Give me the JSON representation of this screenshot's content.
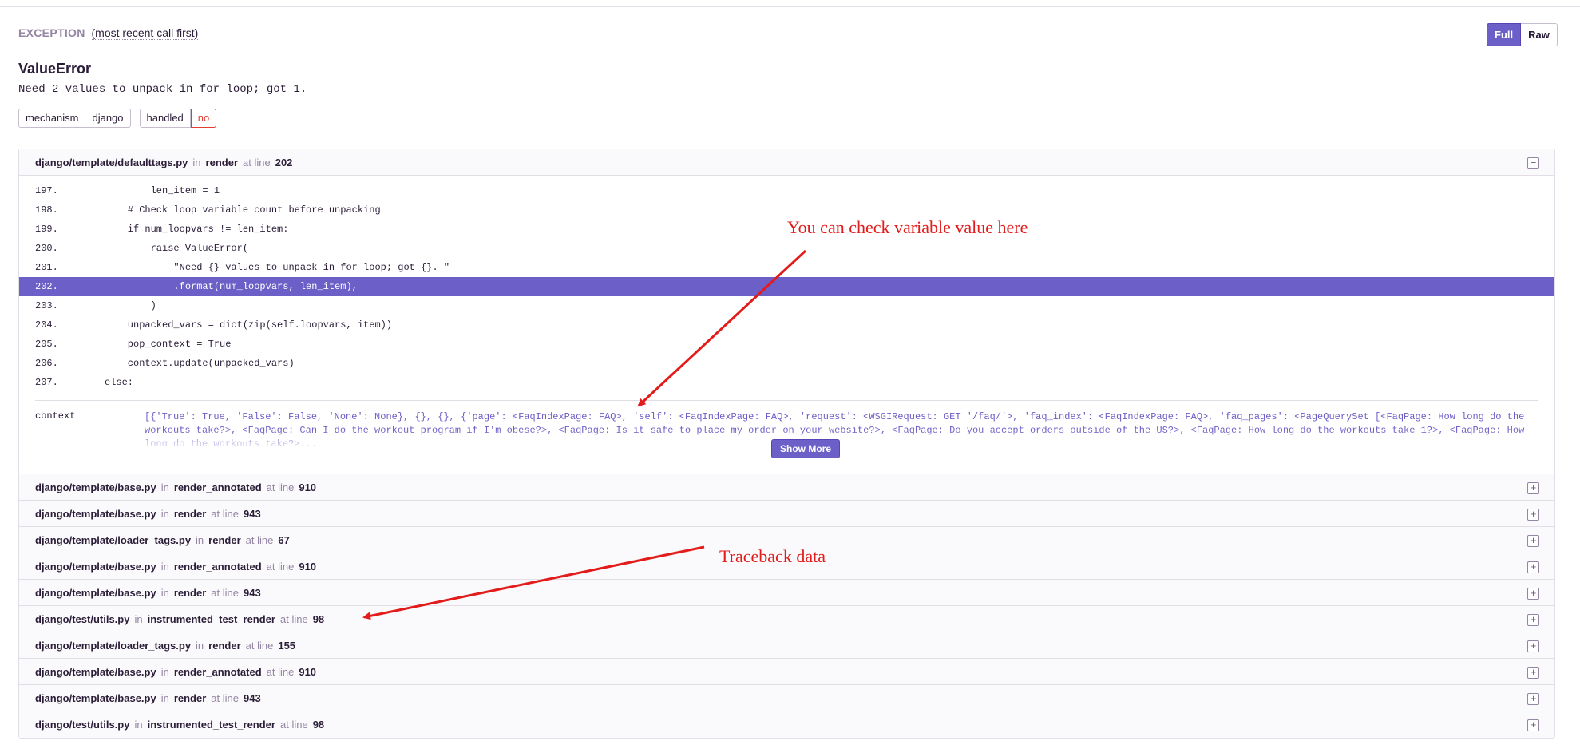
{
  "exception": {
    "section_label": "EXCEPTION",
    "section_sub": "(most recent call first)",
    "type": "ValueError",
    "message": "Need 2 values to unpack in for loop; got 1."
  },
  "view_toggle": {
    "full_label": "Full",
    "raw_label": "Raw"
  },
  "tags": [
    {
      "key": "mechanism",
      "value": "django"
    },
    {
      "key": "handled",
      "value": "no"
    }
  ],
  "labels": {
    "in": "in",
    "at_line": "at line"
  },
  "expanded_frame": {
    "file": "django/template/defaulttags.py",
    "function": "render",
    "line": "202",
    "collapse_symbol": "−",
    "code": [
      {
        "no": "197.",
        "src": "        len_item = 1"
      },
      {
        "no": "198.",
        "src": "    # Check loop variable count before unpacking"
      },
      {
        "no": "199.",
        "src": "    if num_loopvars != len_item:"
      },
      {
        "no": "200.",
        "src": "        raise ValueError("
      },
      {
        "no": "201.",
        "src": "            \"Need {} values to unpack in for loop; got {}. \""
      },
      {
        "no": "202.",
        "src": "            .format(num_loopvars, len_item),"
      },
      {
        "no": "203.",
        "src": "        )"
      },
      {
        "no": "204.",
        "src": "    unpacked_vars = dict(zip(self.loopvars, item))"
      },
      {
        "no": "205.",
        "src": "    pop_context = True"
      },
      {
        "no": "206.",
        "src": "    context.update(unpacked_vars)"
      },
      {
        "no": "207.",
        "src": "else:"
      }
    ],
    "active_line": "202.",
    "var_key": "context",
    "var_value": "[{'True': True, 'False': False, 'None': None}, {}, {}, {'page': <FaqIndexPage: FAQ>, 'self': <FaqIndexPage: FAQ>, 'request': <WSGIRequest: GET '/faq/'>, 'faq_index': <FaqIndexPage: FAQ>, 'faq_pages': <PageQuerySet [<FaqPage: How long do the workouts take?>, <FaqPage: Can I do the workout program if I'm obese?>, <FaqPage: Is it safe to place my order on your website?>, <FaqPage: Do you accept orders outside of the US?>, <FaqPage: How long do the workouts take 1?>, <FaqPage: How long do the workouts take?>...",
    "show_more_label": "Show More"
  },
  "frames": [
    {
      "file": "django/template/base.py",
      "function": "render_annotated",
      "line": "910"
    },
    {
      "file": "django/template/base.py",
      "function": "render",
      "line": "943"
    },
    {
      "file": "django/template/loader_tags.py",
      "function": "render",
      "line": "67"
    },
    {
      "file": "django/template/base.py",
      "function": "render_annotated",
      "line": "910"
    },
    {
      "file": "django/template/base.py",
      "function": "render",
      "line": "943"
    },
    {
      "file": "django/test/utils.py",
      "function": "instrumented_test_render",
      "line": "98"
    },
    {
      "file": "django/template/loader_tags.py",
      "function": "render",
      "line": "155"
    },
    {
      "file": "django/template/base.py",
      "function": "render_annotated",
      "line": "910"
    },
    {
      "file": "django/template/base.py",
      "function": "render",
      "line": "943"
    },
    {
      "file": "django/test/utils.py",
      "function": "instrumented_test_render",
      "line": "98"
    }
  ],
  "expand_symbol": "+",
  "annotations": {
    "variable_note": "You can check variable value here",
    "traceback_note": "Traceback data"
  },
  "colors": {
    "accent": "#6c5fc7",
    "annotation": "#e31b1b",
    "danger": "#e03e2f"
  }
}
